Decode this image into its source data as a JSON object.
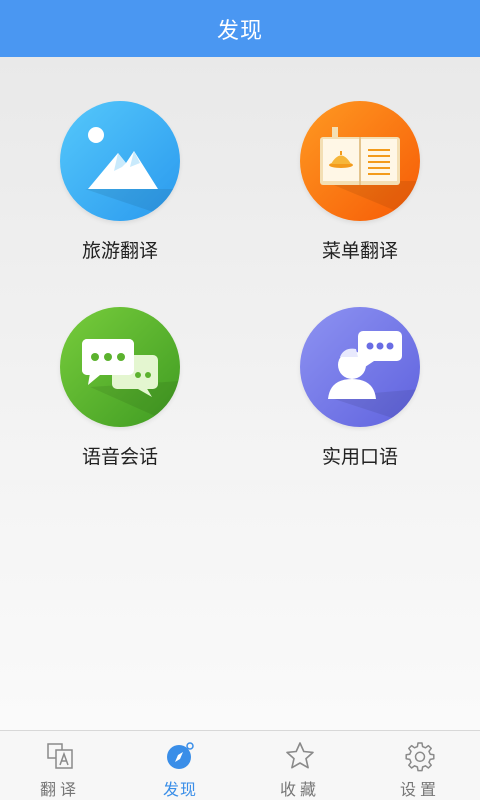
{
  "header": {
    "title": "发现"
  },
  "tiles": [
    {
      "label": "旅游翻译",
      "icon": "mountain-landscape-icon"
    },
    {
      "label": "菜单翻译",
      "icon": "menu-book-icon"
    },
    {
      "label": "语音会话",
      "icon": "chat-bubbles-icon"
    },
    {
      "label": "实用口语",
      "icon": "speaking-person-icon"
    }
  ],
  "tabs": [
    {
      "label": "翻译",
      "icon": "translate-icon"
    },
    {
      "label": "发现",
      "icon": "compass-icon",
      "active": true
    },
    {
      "label": "收藏",
      "icon": "star-icon"
    },
    {
      "label": "设置",
      "icon": "gear-icon"
    }
  ],
  "colors": {
    "header": "#4a97f2",
    "active_tab": "#3a8ee8",
    "inactive_tab": "#777777"
  }
}
